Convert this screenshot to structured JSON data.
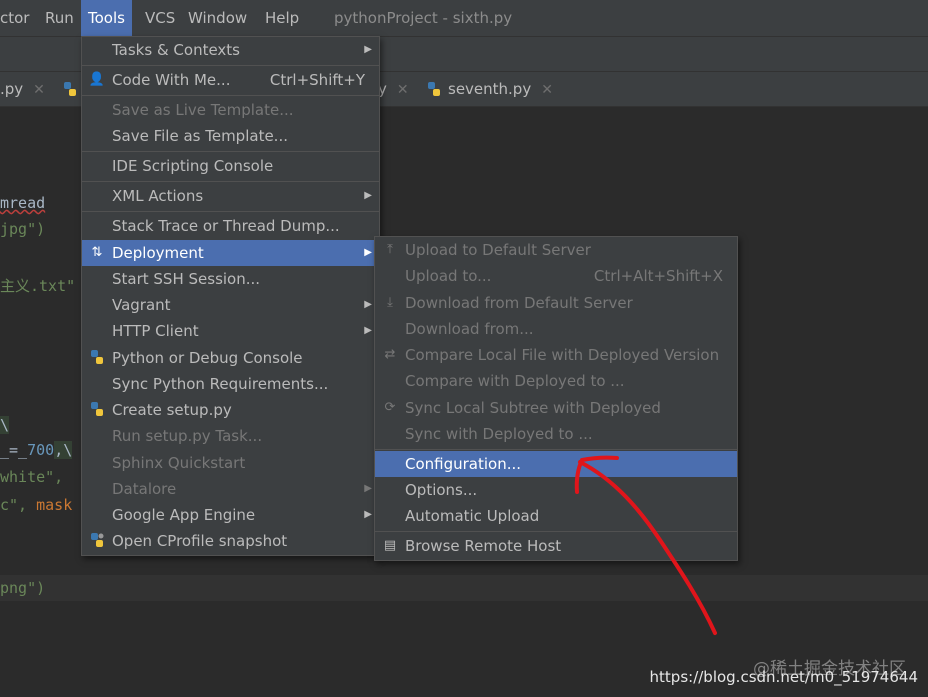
{
  "menubar": {
    "items": [
      {
        "label": "ctor"
      },
      {
        "label": "Run"
      },
      {
        "label": "Tools"
      },
      {
        "label": "VCS"
      },
      {
        "label": "Window"
      },
      {
        "label": "Help"
      }
    ],
    "window_title": "pythonProject - sixth.py"
  },
  "tabs": [
    {
      "label": ".py"
    },
    {
      "label": "y"
    },
    {
      "label": "seventh.py"
    }
  ],
  "code_fragments": {
    "l1": "mread",
    "l2": "jpg\")",
    "l3": "主义.txt\"",
    "l4": "\\",
    "l5a": "_=_",
    "l5b": "700",
    "l5c": ",\\",
    "l6": "white\",",
    "l7a": "c\", ",
    "l7b": "mask",
    "l8": "png\")"
  },
  "tools_menu": {
    "items": [
      {
        "label": "Tasks & Contexts",
        "submenu": true
      },
      {
        "label": "Code With Me...",
        "shortcut": "Ctrl+Shift+Y"
      },
      {
        "label": "Save as Live Template..."
      },
      {
        "label": "Save File as Template..."
      },
      {
        "label": "IDE Scripting Console"
      },
      {
        "label": "XML Actions",
        "submenu": true
      },
      {
        "label": "Stack Trace or Thread Dump..."
      },
      {
        "label": "Deployment",
        "submenu": true
      },
      {
        "label": "Start SSH Session..."
      },
      {
        "label": "Vagrant",
        "submenu": true
      },
      {
        "label": "HTTP Client",
        "submenu": true
      },
      {
        "label": "Python or Debug Console"
      },
      {
        "label": "Sync Python Requirements..."
      },
      {
        "label": "Create setup.py"
      },
      {
        "label": "Run setup.py Task..."
      },
      {
        "label": "Sphinx Quickstart"
      },
      {
        "label": "Datalore",
        "submenu": true
      },
      {
        "label": "Google App Engine",
        "submenu": true
      },
      {
        "label": "Open CProfile snapshot"
      }
    ]
  },
  "deployment_menu": {
    "items": [
      {
        "label": "Upload to Default Server"
      },
      {
        "label": "Upload to...",
        "shortcut": "Ctrl+Alt+Shift+X"
      },
      {
        "label": "Download from Default Server"
      },
      {
        "label": "Download from..."
      },
      {
        "label": "Compare Local File with Deployed Version"
      },
      {
        "label": "Compare with Deployed to ..."
      },
      {
        "label": "Sync Local Subtree with Deployed"
      },
      {
        "label": "Sync with Deployed to ..."
      },
      {
        "label": "Configuration..."
      },
      {
        "label": "Options..."
      },
      {
        "label": "Automatic Upload"
      },
      {
        "label": "Browse Remote Host"
      }
    ]
  },
  "watermark": "@稀土掘金技术社区",
  "url_watermark": "https://blog.csdn.net/m0_51974644",
  "colors": {
    "selection": "#4b6eaf",
    "annotation_arrow": "#e0151b"
  }
}
